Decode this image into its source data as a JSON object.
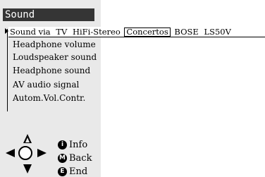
{
  "menu": {
    "title": "Sound",
    "selected_row": {
      "label": "Sound via",
      "options": [
        "TV",
        "HiFi-Stereo",
        "Concertos",
        "BOSE",
        "LS50V"
      ],
      "highlighted_option": "Concertos"
    },
    "items": [
      {
        "label": "Headphone volume"
      },
      {
        "label": "Loudspeaker sound"
      },
      {
        "label": "Headphone sound"
      },
      {
        "label": "AV audio signal"
      },
      {
        "label": "Autom.Vol.Contr."
      }
    ]
  },
  "help_keys": {
    "info": {
      "glyph": "i",
      "label": "Info"
    },
    "back": {
      "glyph": "M",
      "label": "Back"
    },
    "end": {
      "glyph": "E",
      "label": "End"
    }
  },
  "icons": {
    "nav_up": "arrow-up-icon",
    "nav_down": "arrow-down-icon",
    "nav_left": "arrow-left-icon",
    "nav_right": "arrow-right-icon",
    "ok": "ok-circle-icon"
  },
  "colors": {
    "panel_bg": "#e9e9e9",
    "title_bar_bg": "#353535",
    "title_text": "#ffffff"
  }
}
